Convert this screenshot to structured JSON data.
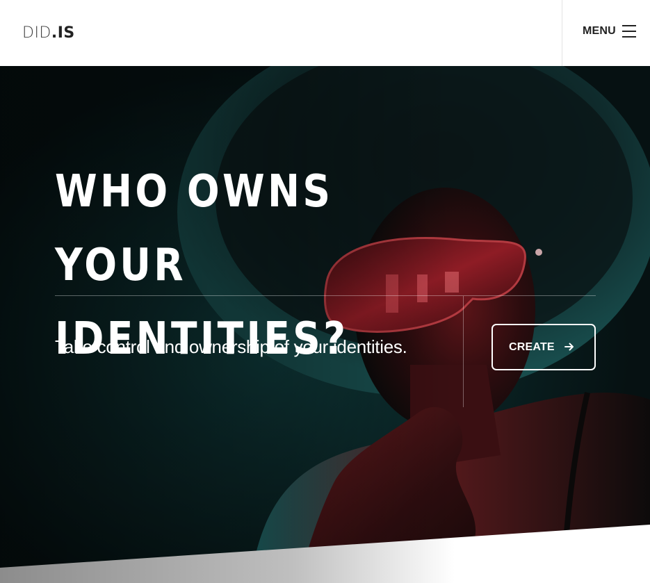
{
  "header": {
    "logo": {
      "light": "DID",
      "bold": ".IS"
    },
    "menu_label": "MENU",
    "menu_icon": "hamburger-icon"
  },
  "hero": {
    "title_line_1": "WHO OWNS YOUR",
    "title_line_2": "IDENTITIES?",
    "subtitle": "Take control and ownership of your identities.",
    "cta_label": "CREATE",
    "cta_icon": "arrow-right-icon",
    "image": "woman-with-red-sunglasses-photo"
  },
  "colors": {
    "text_dark": "#222222",
    "hero_bg": "#071516",
    "teal_light": "#1f6a6a",
    "red_light": "#8a1f24",
    "white": "#ffffff"
  }
}
